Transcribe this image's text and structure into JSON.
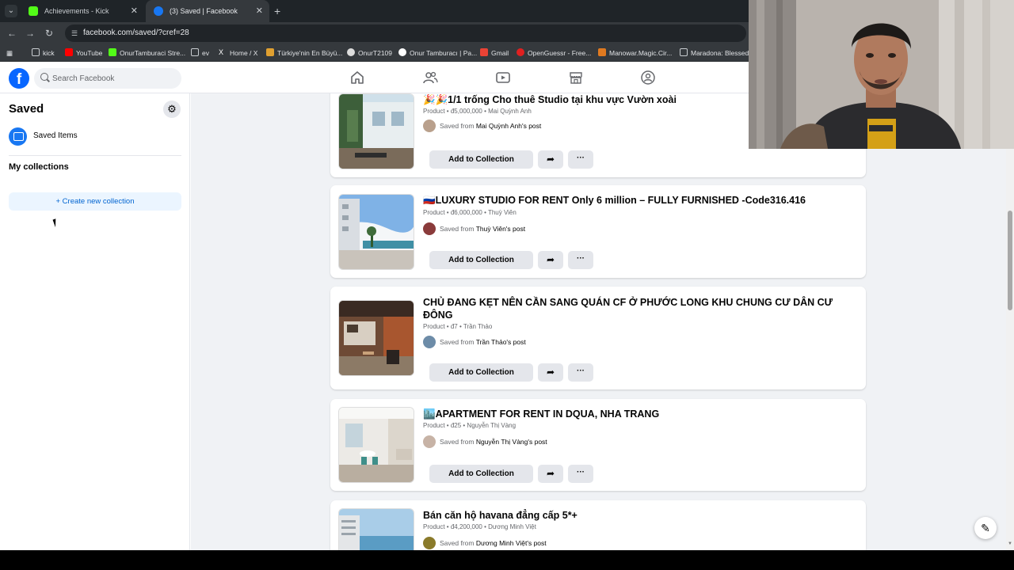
{
  "browser": {
    "tabs": [
      {
        "title": "Achievements - Kick Dashboard",
        "favicon_color": "#53fc18",
        "active": false
      },
      {
        "title": "(3) Saved | Facebook",
        "favicon_color": "#1877f2",
        "active": true
      }
    ],
    "new_tab": "+",
    "url": "facebook.com/saved/?cref=28",
    "bookmarks": [
      {
        "label": "kick",
        "color": "#c8ccd0"
      },
      {
        "label": "YouTube",
        "color": "#ff0000"
      },
      {
        "label": "OnurTamburaci Stre...",
        "color": "#53fc18"
      },
      {
        "label": "ev",
        "color": "#c8ccd0"
      },
      {
        "label": "Home / X",
        "color": "#ffffff"
      },
      {
        "label": "Türkiye'nin En Büyü...",
        "color": "#e0a030"
      },
      {
        "label": "OnurT2109",
        "color": "#dddddd"
      },
      {
        "label": "Onur Tamburacı | Pa...",
        "color": "#ffffff"
      },
      {
        "label": "Gmail",
        "color": "#ea4335"
      },
      {
        "label": "OpenGuessr - Free...",
        "color": "#e02020"
      },
      {
        "label": "Manowar.Magic.Cir...",
        "color": "#e07a20"
      },
      {
        "label": "Maradona: Blessed...",
        "color": "#c8ccd0"
      }
    ]
  },
  "facebook": {
    "logo": "f",
    "search_placeholder": "Search Facebook",
    "nav_icons": [
      "home-icon",
      "friends-icon",
      "video-icon",
      "marketplace-icon",
      "groups-icon"
    ]
  },
  "sidebar": {
    "title": "Saved",
    "saved_items": "Saved Items",
    "my_collections": "My collections",
    "create_collection": "Create new collection"
  },
  "items": [
    {
      "title": "🎉🎉1/1 trống Cho thuê Studio tại khu vực Vườn xoài",
      "meta": "Product • đ5,000,000 • Mai Quỳnh Anh",
      "saved_prefix": "Saved from",
      "saved_source": "Mai Quỳnh Anh's post",
      "add_label": "Add to Collection"
    },
    {
      "title": "🇷🇺LUXURY STUDIO FOR RENT Only 6 million – FULLY FURNISHED -Code316.416",
      "meta": "Product • đ6,000,000 • Thuỳ Viên",
      "saved_prefix": "Saved from",
      "saved_source": "Thuỳ Viên's post",
      "add_label": "Add to Collection"
    },
    {
      "title": "CHỦ ĐANG KẸT NÊN CẦN SANG QUÁN CF Ở PHƯỚC LONG KHU CHUNG CƯ DÂN CƯ ĐÔNG",
      "meta": "Product • đ7 • Trần Thảo",
      "saved_prefix": "Saved from",
      "saved_source": "Trần Thảo's post",
      "add_label": "Add to Collection"
    },
    {
      "title": "🏙️APARTMENT FOR RENT IN DQUA, NHA TRANG",
      "meta": "Product • đ25 • Nguyễn Thị Vàng",
      "saved_prefix": "Saved from",
      "saved_source": "Nguyễn Thị Vàng's post",
      "add_label": "Add to Collection"
    },
    {
      "title": "Bán căn hộ havana đẳng cấp 5*+",
      "meta": "Product • đ4,200,000 • Dương Minh Việt",
      "saved_prefix": "Saved from",
      "saved_source": "Dương Minh Việt's post",
      "add_label": "Add to Collection"
    }
  ],
  "colors": {
    "facebook_blue": "#0866ff",
    "link_blue": "#0064d1",
    "feed_bg": "#f0f2f5",
    "button_gray": "#e4e6eb"
  }
}
